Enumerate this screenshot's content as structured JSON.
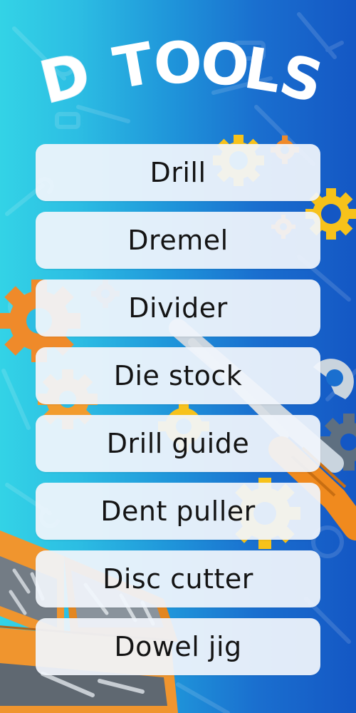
{
  "title": {
    "letters": [
      "D",
      "T",
      "O",
      "O",
      "L",
      "S"
    ]
  },
  "tools": [
    {
      "label": "Drill"
    },
    {
      "label": "Dremel"
    },
    {
      "label": "Divider"
    },
    {
      "label": "Die stock"
    },
    {
      "label": "Drill guide"
    },
    {
      "label": "Dent puller"
    },
    {
      "label": "Disc cutter"
    },
    {
      "label": "Dowel jig"
    }
  ],
  "colors": {
    "background_left": "#33d3e6",
    "background_right": "#1457c4",
    "title": "#ffffff",
    "card": "#f1f5fc",
    "text": "#141414",
    "gear_yellow": "#f7c21a",
    "gear_orange": "#ef8a2a",
    "toolbox_orange": "#f0952e"
  },
  "icons": [
    "gear-icon",
    "wrench-icon",
    "screwdriver-icon",
    "toolbox-icon"
  ]
}
